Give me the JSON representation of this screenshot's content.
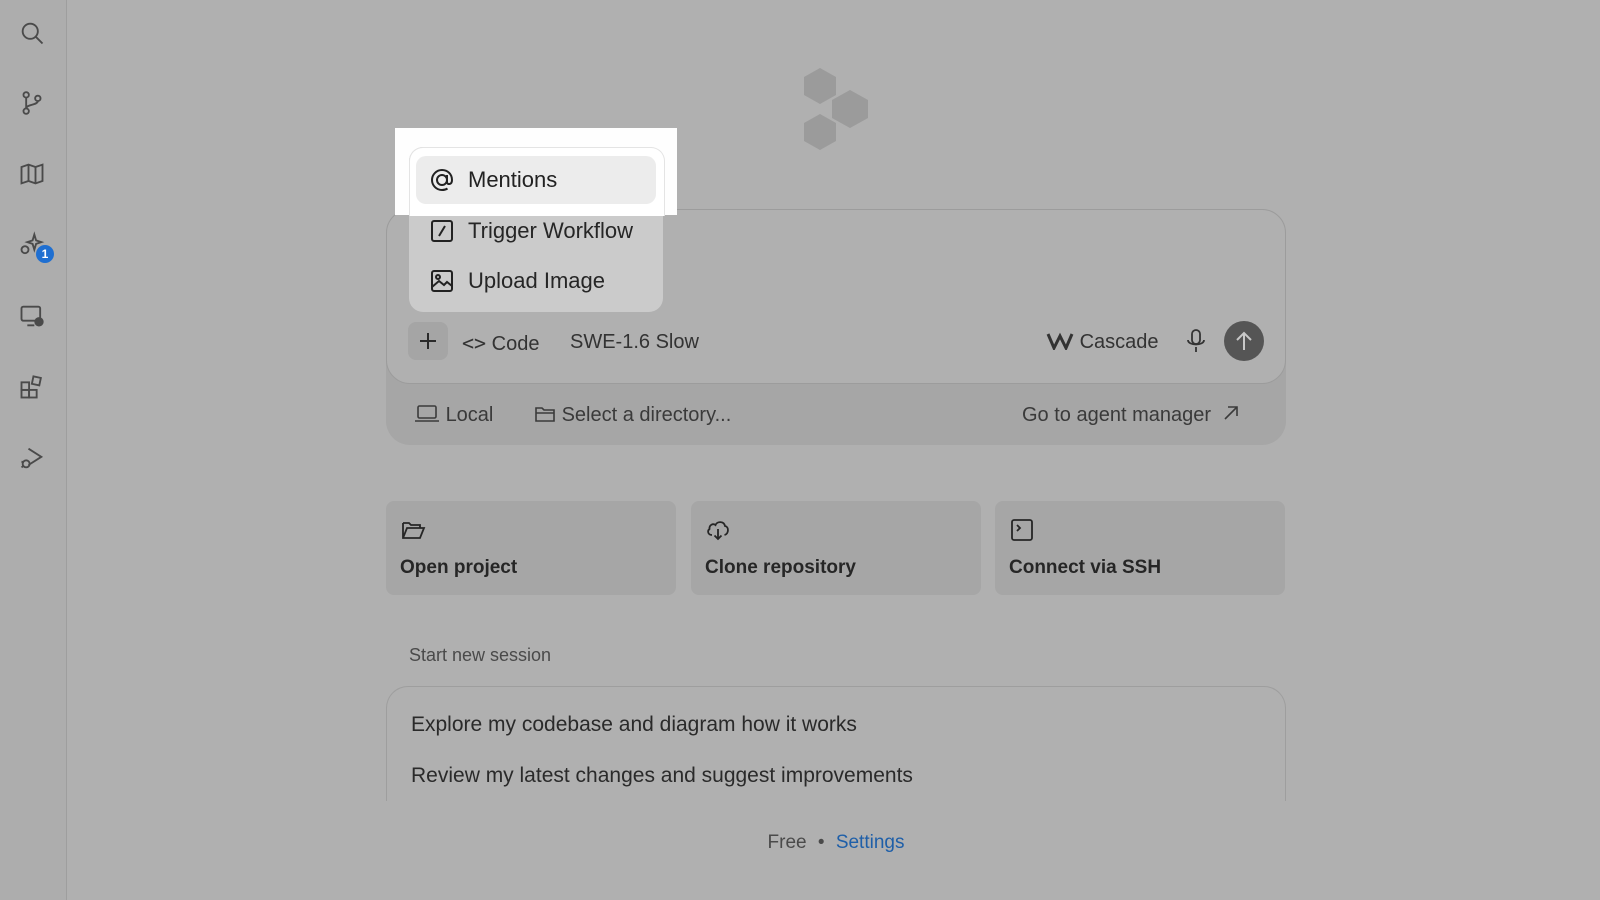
{
  "sidebar": {
    "items": [
      {
        "icon": "search-icon"
      },
      {
        "icon": "git-branch-icon"
      },
      {
        "icon": "map-icon"
      },
      {
        "icon": "sparkles-icon",
        "badge": "1"
      },
      {
        "icon": "remote-screen-icon"
      },
      {
        "icon": "extensions-icon"
      },
      {
        "icon": "run-debug-icon"
      }
    ]
  },
  "menu": {
    "items": [
      {
        "label": "Mentions",
        "icon": "at-icon"
      },
      {
        "label": "Trigger Workflow",
        "icon": "slash-command-icon"
      },
      {
        "label": "Upload Image",
        "icon": "image-icon"
      }
    ]
  },
  "composer": {
    "mode_label": "Code",
    "model_label": "SWE-1.6 Slow",
    "agent_label": "Cascade",
    "env_label": "Local",
    "directory_placeholder": "Select a directory...",
    "agent_manager_link": "Go to agent manager"
  },
  "cards": [
    {
      "label": "Open project",
      "icon": "folder-open-icon"
    },
    {
      "label": "Clone repository",
      "icon": "cloud-download-icon"
    },
    {
      "label": "Connect via SSH",
      "icon": "terminal-icon"
    }
  ],
  "sessions": {
    "title": "Start new session",
    "suggestions": [
      "Explore my codebase and diagram how it works",
      "Review my latest changes and suggest improvements"
    ]
  },
  "footer": {
    "plan": "Free",
    "separator": "•",
    "settings_link": "Settings"
  },
  "colors": {
    "accent_blue": "#1f6fd1",
    "link_blue": "#1f5fa8",
    "overlay_gray": "#b0b0b0"
  }
}
